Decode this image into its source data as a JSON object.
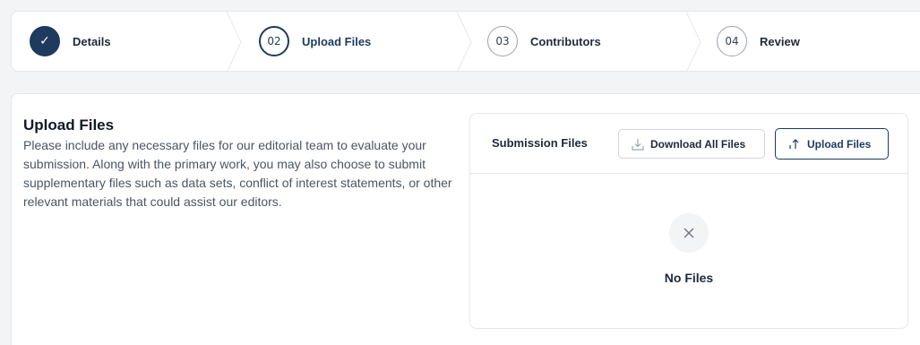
{
  "stepper": {
    "steps": [
      {
        "number": "✓",
        "label": "Details",
        "state": "done"
      },
      {
        "number": "02",
        "label": "Upload Files",
        "state": "active"
      },
      {
        "number": "03",
        "label": "Contributors",
        "state": "pending"
      },
      {
        "number": "04",
        "label": "Review",
        "state": "pending"
      }
    ]
  },
  "section": {
    "title": "Upload Files",
    "description": "Please include any necessary files for our editorial team to evaluate your submission. Along with the primary work, you may also choose to submit supplementary files such as data sets, conflict of interest statements, or other relevant materials that could assist our editors."
  },
  "files": {
    "title": "Submission Files",
    "download_all_label": "Download All Files",
    "upload_label": "Upload Files",
    "empty_label": "No Files"
  },
  "colors": {
    "primary": "#1e3a5f",
    "border": "#e5e7eb",
    "background": "#f3f4f6"
  },
  "icons": {
    "done": "check-icon",
    "download": "download-icon",
    "upload": "upload-icon",
    "empty": "close-icon"
  }
}
